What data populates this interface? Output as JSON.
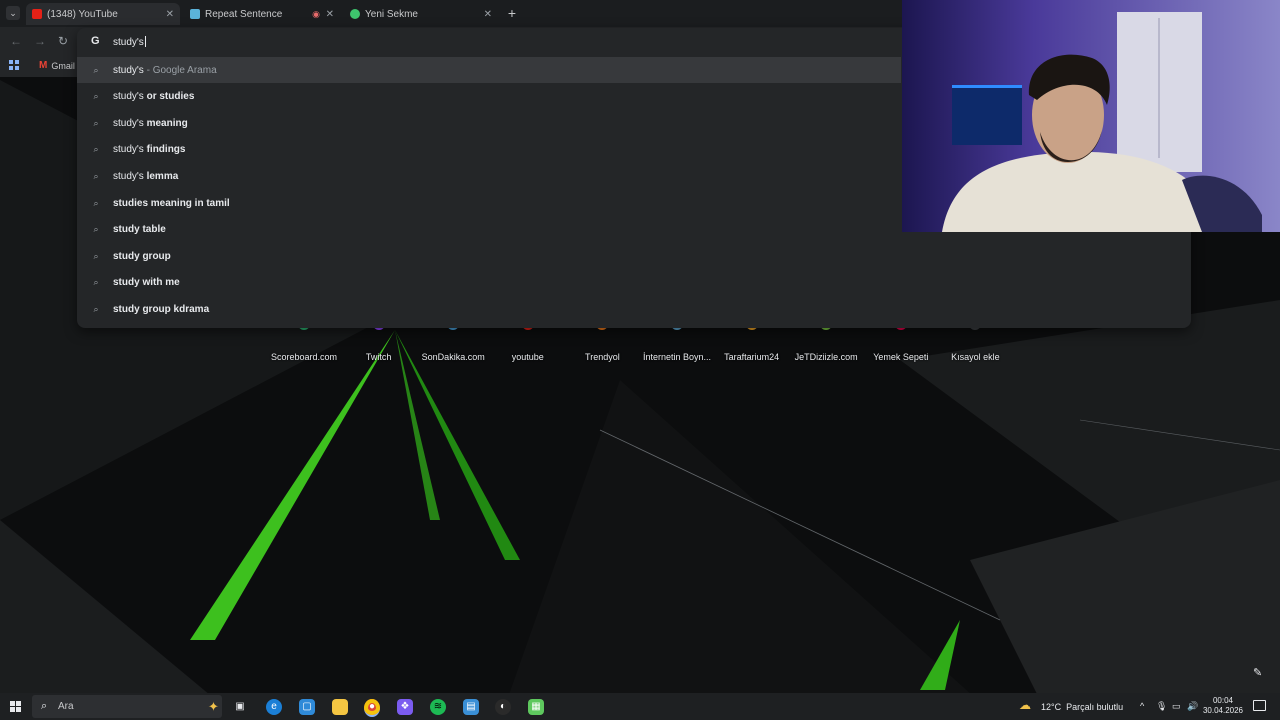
{
  "browser": {
    "tabs": [
      {
        "title": "(1348) YouTube",
        "icon": "youtube-icon",
        "active": true
      },
      {
        "title": "Repeat Sentence",
        "icon": "repeat-sentence-icon",
        "active": false
      },
      {
        "title": "Yeni Sekme",
        "icon": "chrome-newtab-icon",
        "active": false
      }
    ],
    "new_tab_label": "+",
    "bookmarks": [
      {
        "label": "Gmail",
        "icon": "gmail-icon"
      }
    ]
  },
  "omnibox": {
    "logo": "G",
    "query": "study's",
    "suggestions": [
      {
        "prefix": "study's",
        "bold": "",
        "suffix": " - Google Arama",
        "highlighted": true
      },
      {
        "prefix": "study's ",
        "bold": "or studies",
        "suffix": "",
        "highlighted": false
      },
      {
        "prefix": "study's ",
        "bold": "meaning",
        "suffix": "",
        "highlighted": false
      },
      {
        "prefix": "study's ",
        "bold": "findings",
        "suffix": "",
        "highlighted": false
      },
      {
        "prefix": "study's ",
        "bold": "lemma",
        "suffix": "",
        "highlighted": false
      },
      {
        "prefix": "",
        "bold": "studies meaning in tamil",
        "suffix": "",
        "highlighted": false
      },
      {
        "prefix": "",
        "bold": "study table",
        "suffix": "",
        "highlighted": false
      },
      {
        "prefix": "",
        "bold": "study group",
        "suffix": "",
        "highlighted": false
      },
      {
        "prefix": "",
        "bold": "study with me",
        "suffix": "",
        "highlighted": false
      },
      {
        "prefix": "",
        "bold": "study group kdrama",
        "suffix": "",
        "highlighted": false
      }
    ]
  },
  "shortcuts": [
    {
      "label": "Scoreboard.com",
      "color": "#2bb673"
    },
    {
      "label": "Twitch",
      "color": "#9146ff"
    },
    {
      "label": "SonDakika.com",
      "color": "#4aa3df"
    },
    {
      "label": "youtube",
      "color": "#e62117"
    },
    {
      "label": "Trendyol",
      "color": "#f27a1a"
    },
    {
      "label": "İnternetin Boyn...",
      "color": "#5fa8d3"
    },
    {
      "label": "Taraftarium24",
      "color": "#f5a623"
    },
    {
      "label": "JeTDiziizle.com",
      "color": "#7ac943"
    },
    {
      "label": "Yemek Sepeti",
      "color": "#ea004b"
    },
    {
      "label": "Kısayol ekle",
      "color": "#3c4043"
    }
  ],
  "taskbar": {
    "search_placeholder": "Ara",
    "weather_temp": "12°C",
    "weather_text": "Parçalı bulutlu",
    "time": "00:04",
    "date": "30.04.2026"
  }
}
